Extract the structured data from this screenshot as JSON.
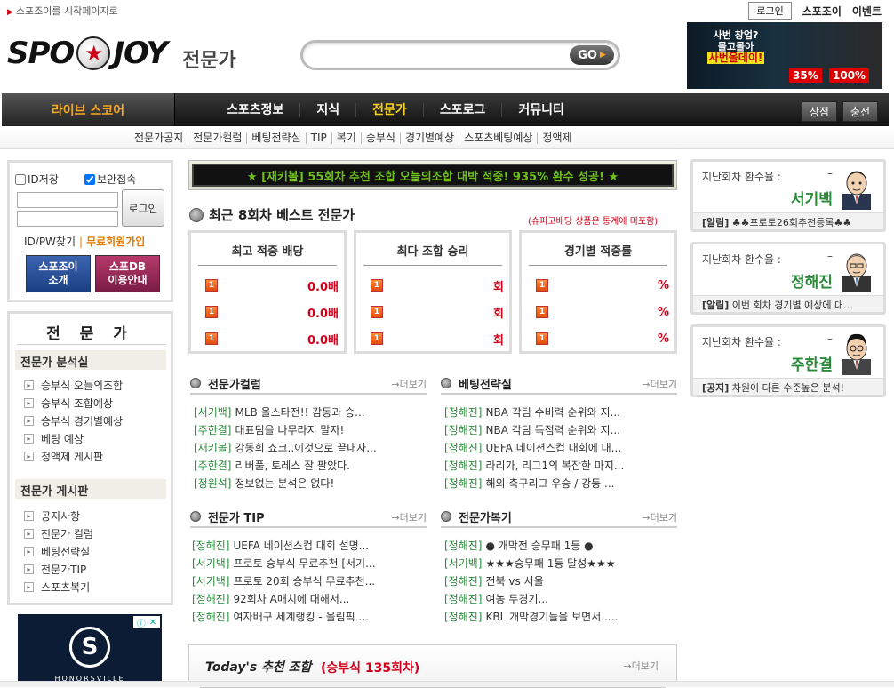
{
  "top": {
    "home_link": "스포조이를 시작페이지로",
    "login": "로그인",
    "spojoy": "스포조이",
    "event": "이벤트"
  },
  "logo": {
    "left": "SPO",
    "right": "JOY",
    "sub": "전문가"
  },
  "search": {
    "placeholder": "",
    "go": "GO"
  },
  "banner": {
    "line1": "사번 창업?",
    "line2": "몰고몰아",
    "line3": "사번올데이!",
    "n1": "35%",
    "n2": "100%"
  },
  "nav": {
    "live": "라이브 스코어",
    "items": [
      "스포츠정보",
      "지식",
      "전문가",
      "스포로그",
      "커뮤니티"
    ],
    "active": "전문가",
    "shop": "상점",
    "charge": "충전"
  },
  "subnav": [
    "전문가공지",
    "전문가컬럼",
    "베팅전략실",
    "TIP",
    "복기",
    "승부식",
    "경기별예상",
    "스포츠베팅예상",
    "정액제"
  ],
  "login_box": {
    "save_id": "ID저장",
    "secure": "보안접속",
    "login_btn": "로그인",
    "find": "ID/PW찾기",
    "join": "무료회원가입",
    "btn1_l1": "스포조이",
    "btn1_l2": "소개",
    "btn2_l1": "스포DB",
    "btn2_l2": "이용안내"
  },
  "expert_menu": {
    "title": "전 문 가",
    "sec1": "전문가 분석실",
    "sec1_items": [
      "승부식 오늘의조합",
      "승부식 조합예상",
      "승부식 경기별예상",
      "베팅 예상",
      "정액제 게시판"
    ],
    "sec2": "전문가 게시판",
    "sec2_items": [
      "공지사항",
      "전문가 컬럼",
      "베팅전략실",
      "전문가TIP",
      "스포츠복기"
    ]
  },
  "ad_left": {
    "brand": "HONORSVILLE",
    "logo": "S"
  },
  "ticker": "★ [재키볼] 55회차 추천 조합 오늘의조합 대박 적중! 935% 환수 성공! ★",
  "best": {
    "title": "최근 8회차 베스트 전문가",
    "note": "(슈퍼고배당 상품은 통계에 미포함)",
    "boxes": [
      {
        "head": "최고 적중 배당",
        "rows": [
          {
            "no": "1",
            "val": "0.0배"
          },
          {
            "no": "1",
            "val": "0.0배"
          },
          {
            "no": "1",
            "val": "0.0배"
          }
        ]
      },
      {
        "head": "최다 조합 승리",
        "rows": [
          {
            "no": "1",
            "val": "회"
          },
          {
            "no": "1",
            "val": "회"
          },
          {
            "no": "1",
            "val": "회"
          }
        ]
      },
      {
        "head": "경기별 적중률",
        "rows": [
          {
            "no": "1",
            "val": "%"
          },
          {
            "no": "1",
            "val": "%"
          },
          {
            "no": "1",
            "val": "%"
          }
        ]
      }
    ]
  },
  "sections": {
    "column": {
      "title": "전문가컬럼",
      "more": "→더보기",
      "items": [
        {
          "au": "[서기백]",
          "t": "MLB 올스타전!! 감동과 승..."
        },
        {
          "au": "[주한결]",
          "t": "대표팀을 나무라지 말자!"
        },
        {
          "au": "[재키볼]",
          "t": "강동희 쇼크..이것으로 끝내자..."
        },
        {
          "au": "[주한결]",
          "t": "리버풀, 토레스 잘 팔았다."
        },
        {
          "au": "[정원석]",
          "t": "정보없는 분석은 없다!"
        }
      ]
    },
    "strategy": {
      "title": "베팅전략실",
      "more": "→더보기",
      "items": [
        {
          "au": "[정해진]",
          "t": "NBA 각팀 수비력 순위와 지..."
        },
        {
          "au": "[정해진]",
          "t": "NBA 각팀 득점력 순위와 지..."
        },
        {
          "au": "[정해진]",
          "t": "UEFA 네이션스컵 대회에 대..."
        },
        {
          "au": "[정해진]",
          "t": "라리가, 리그1의 복잡한 마지..."
        },
        {
          "au": "[정해진]",
          "t": "해외 축구리그 우승 / 강등 ..."
        }
      ]
    },
    "tip": {
      "title": "전문가 TIP",
      "more": "→더보기",
      "items": [
        {
          "au": "[정해진]",
          "t": "UEFA 네이션스컵 대회 설명..."
        },
        {
          "au": "[서기백]",
          "t": "프로토 승부식 무료추천 [서기..."
        },
        {
          "au": "[서기백]",
          "t": "프로토 20회 승부식 무료추천..."
        },
        {
          "au": "[정해진]",
          "t": "92회차 A매치에 대해서..."
        },
        {
          "au": "[정해진]",
          "t": "여자배구 세계랭킹 - 올림픽 ..."
        }
      ]
    },
    "review": {
      "title": "전문가복기",
      "more": "→더보기",
      "items": [
        {
          "au": "[정해진]",
          "t": "● 개막전 승무패 1등 ●"
        },
        {
          "au": "[서기백]",
          "t": "★★★승무패 1등 달성★★★"
        },
        {
          "au": "[정해진]",
          "t": "전북 vs 서울"
        },
        {
          "au": "[정해진]",
          "t": "여농 두경기..."
        },
        {
          "au": "[정해진]",
          "t": "KBL 개막경기들을 보면서....."
        }
      ]
    }
  },
  "today": {
    "label": "Today's 추천 조합",
    "round": "(승부식 135회차)",
    "more": "→더보기"
  },
  "experts": [
    {
      "label": "지난회차 환수율 :",
      "dash": "–",
      "name": "서기백",
      "tag": "[알림]",
      "note": "♣♣프로토26회추천등록♣♣"
    },
    {
      "label": "지난회차 환수율 :",
      "dash": "–",
      "name": "정해진",
      "tag": "[알림]",
      "note": "이번 회차 경기별 예상에 대..."
    },
    {
      "label": "지난회차 환수율 :",
      "dash": "–",
      "name": "주한결",
      "tag": "[공지]",
      "note": "차원이 다른 수준높은 분석!"
    }
  ]
}
